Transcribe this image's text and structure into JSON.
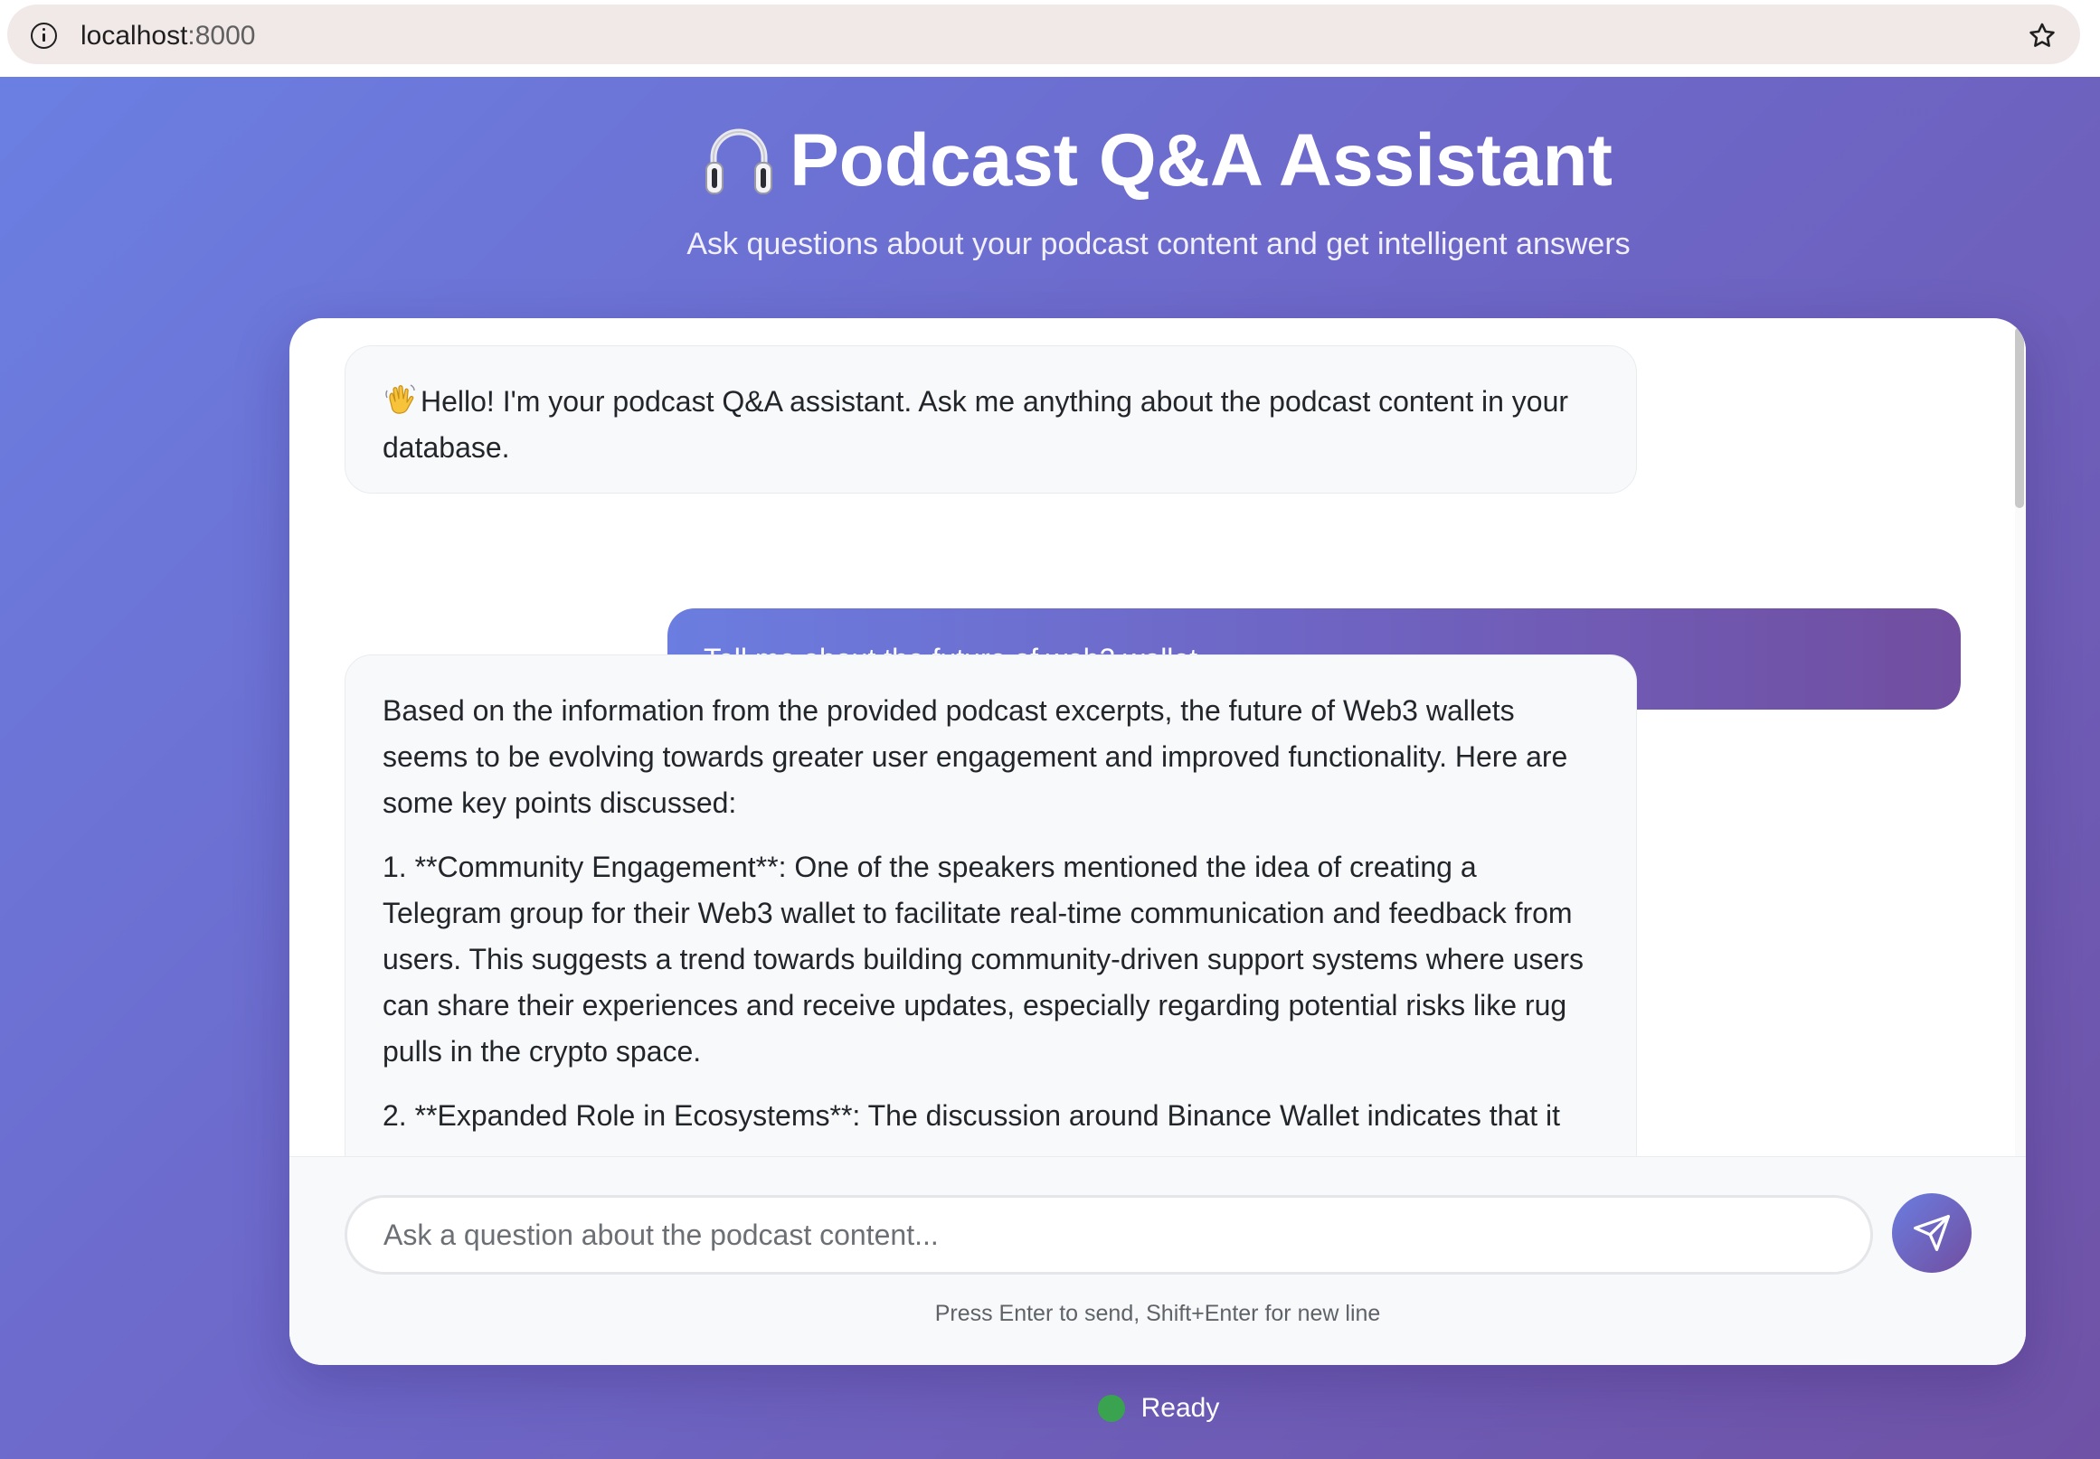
{
  "browser": {
    "url_host": "localhost",
    "url_port": ":8000"
  },
  "header": {
    "title": "Podcast Q&A Assistant",
    "subtitle": "Ask questions about your podcast content and get intelligent answers"
  },
  "chat": {
    "messages": [
      {
        "role": "assistant",
        "paragraphs": [
          "Hello! I'm your podcast Q&A assistant. Ask me anything about the podcast content in your database."
        ]
      },
      {
        "role": "user",
        "text": "Tell me about the future of web3 wallet"
      },
      {
        "role": "assistant",
        "paragraphs": [
          "Based on the information from the provided podcast excerpts, the future of Web3 wallets seems to be evolving towards greater user engagement and improved functionality. Here are some key points discussed:",
          "1. **Community Engagement**: One of the speakers mentioned the idea of creating a Telegram group for their Web3 wallet to facilitate real-time communication and feedback from users. This suggests a trend towards building community-driven support systems where users can share their experiences and receive updates, especially regarding potential risks like rug pulls in the crypto space.",
          "2. **Expanded Role in Ecosystems**: The discussion around Binance Wallet indicates that it"
        ]
      }
    ]
  },
  "input": {
    "placeholder": "Ask a question about the podcast content...",
    "value": "",
    "hint": "Press Enter to send, Shift+Enter for new line"
  },
  "status": {
    "label": "Ready",
    "color": "#3aa34f"
  },
  "icons": {
    "browser_info": "info-icon",
    "bookmark": "star-icon",
    "title": "headphones-icon",
    "greeting": "waving-hand-icon",
    "send": "send-icon"
  },
  "colors": {
    "gradient_start": "#6b7fe2",
    "gradient_end": "#6f52a6",
    "assistant_bubble": "#f8f9fa",
    "status_dot": "#3aa34f"
  }
}
